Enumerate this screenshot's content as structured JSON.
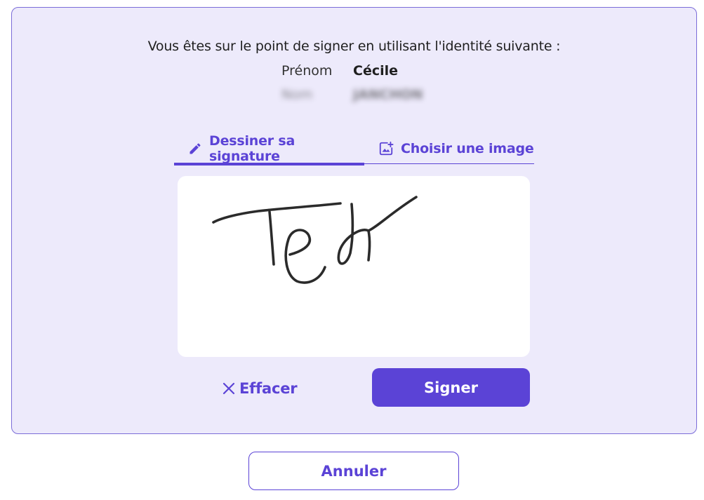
{
  "intro_text": "Vous êtes sur le point de signer en utilisant l'identité suivante :",
  "identity": {
    "first_name_label": "Prénom",
    "first_name_value": "Cécile",
    "last_name_label": "Nom",
    "last_name_value": "JANCHON"
  },
  "tabs": {
    "draw_label": "Dessiner sa signature",
    "image_label": "Choisir une image",
    "active": "draw"
  },
  "actions": {
    "clear_label": "Effacer",
    "sign_label": "Signer",
    "cancel_label": "Annuler"
  },
  "icons": {
    "draw_tab_icon": "pencil-icon",
    "image_tab_icon": "add-image-icon",
    "clear_icon": "close-icon"
  },
  "colors": {
    "accent": "#5b43d6",
    "panel_background": "#edeafb",
    "ink": "#2b2b2b"
  }
}
